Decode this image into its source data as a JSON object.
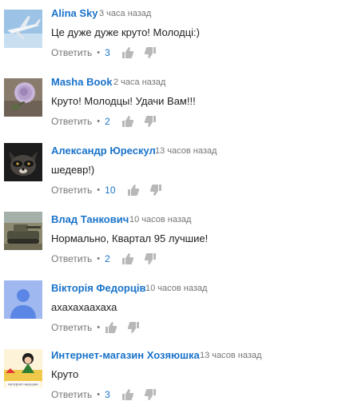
{
  "comments": [
    {
      "author": "Alina Sky",
      "time": "3 часа назад",
      "text": "Це дуже дуже круто! Молодці:)",
      "reply_label": "Ответить",
      "likes": "3",
      "avatar": "airplane-avatar"
    },
    {
      "author": "Masha Book",
      "time": "2 часа назад",
      "text": "Круто!  Молодцы!  Удачи Вам!!!",
      "reply_label": "Ответить",
      "likes": "2",
      "avatar": "rose-avatar"
    },
    {
      "author": "Александр Юрескул",
      "time": "13 часов назад",
      "text": "шедевр!)",
      "reply_label": "Ответить",
      "likes": "10",
      "avatar": "raccoon-avatar"
    },
    {
      "author": "Влад Танкович",
      "time": "10 часов назад",
      "text": "Нормально, Квартал 95 лучшие!",
      "reply_label": "Ответить",
      "likes": "2",
      "avatar": "tank-avatar"
    },
    {
      "author": "Вікторія Федорців",
      "time": "10 часов назад",
      "text": "ахахахаахаха",
      "reply_label": "Ответить",
      "likes": "",
      "avatar": "default-user-avatar"
    },
    {
      "author": "Интернет-магазин Хозяюшка",
      "time": "13 часов назад",
      "text": "Круто",
      "reply_label": "Ответить",
      "likes": "3",
      "avatar": "shop-logo-avatar",
      "logo_text": "интернет-магазин"
    }
  ],
  "colors": {
    "link": "#1a73c9",
    "meta": "#767676",
    "text": "#222222",
    "icon": "#b8b8b8"
  }
}
